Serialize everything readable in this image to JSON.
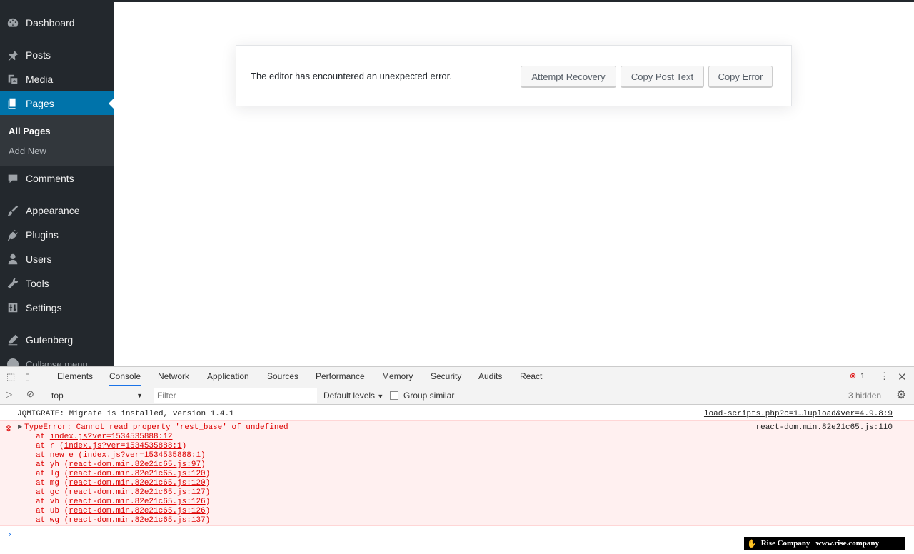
{
  "sidebar": {
    "items": [
      {
        "label": "Dashboard",
        "icon": "dashboard-icon"
      },
      {
        "label": "Posts",
        "icon": "pin-icon"
      },
      {
        "label": "Media",
        "icon": "media-icon"
      },
      {
        "label": "Pages",
        "icon": "pages-icon",
        "active": true
      },
      {
        "label": "Comments",
        "icon": "comments-icon"
      },
      {
        "label": "Appearance",
        "icon": "brush-icon"
      },
      {
        "label": "Plugins",
        "icon": "plugin-icon"
      },
      {
        "label": "Users",
        "icon": "users-icon"
      },
      {
        "label": "Tools",
        "icon": "wrench-icon"
      },
      {
        "label": "Settings",
        "icon": "settings-icon"
      },
      {
        "label": "Gutenberg",
        "icon": "pencil-icon"
      }
    ],
    "submenu": [
      {
        "label": "All Pages",
        "current": true
      },
      {
        "label": "Add New"
      }
    ],
    "collapse_label": "Collapse menu"
  },
  "editor": {
    "error_message": "The editor has encountered an unexpected error.",
    "buttons": {
      "recovery": "Attempt Recovery",
      "copy_post": "Copy Post Text",
      "copy_error": "Copy Error"
    }
  },
  "devtools": {
    "tabs": [
      "Elements",
      "Console",
      "Network",
      "Application",
      "Sources",
      "Performance",
      "Memory",
      "Security",
      "Audits",
      "React"
    ],
    "selected_tab": "Console",
    "error_count": "1",
    "context": "top",
    "filter_placeholder": "Filter",
    "levels": "Default levels",
    "group_similar": "Group similar",
    "hidden": "3 hidden",
    "log": {
      "text": "JQMIGRATE: Migrate is installed, version 1.4.1",
      "source": "load-scripts.php?c=1…lupload&ver=4.9.8:9"
    },
    "error": {
      "message": "TypeError: Cannot read property 'rest_base' of undefined",
      "source": "react-dom.min.82e21c65.js:110",
      "stack": [
        {
          "prefix": "at ",
          "link": "index.js?ver=1534535888:12",
          "suffix": ""
        },
        {
          "prefix": "at r (",
          "link": "index.js?ver=1534535888:1",
          "suffix": ")"
        },
        {
          "prefix": "at new e (",
          "link": "index.js?ver=1534535888:1",
          "suffix": ")"
        },
        {
          "prefix": "at yh (",
          "link": "react-dom.min.82e21c65.js:97",
          "suffix": ")"
        },
        {
          "prefix": "at lg (",
          "link": "react-dom.min.82e21c65.js:120",
          "suffix": ")"
        },
        {
          "prefix": "at mg (",
          "link": "react-dom.min.82e21c65.js:120",
          "suffix": ")"
        },
        {
          "prefix": "at gc (",
          "link": "react-dom.min.82e21c65.js:127",
          "suffix": ")"
        },
        {
          "prefix": "at vb (",
          "link": "react-dom.min.82e21c65.js:126",
          "suffix": ")"
        },
        {
          "prefix": "at ub (",
          "link": "react-dom.min.82e21c65.js:126",
          "suffix": ")"
        },
        {
          "prefix": "at wg (",
          "link": "react-dom.min.82e21c65.js:137",
          "suffix": ")"
        }
      ]
    }
  },
  "watermark": "Rise Company | www.rise.company",
  "colors": {
    "admin_bg": "#23282d",
    "accent": "#0073aa",
    "error": "#d00000"
  }
}
